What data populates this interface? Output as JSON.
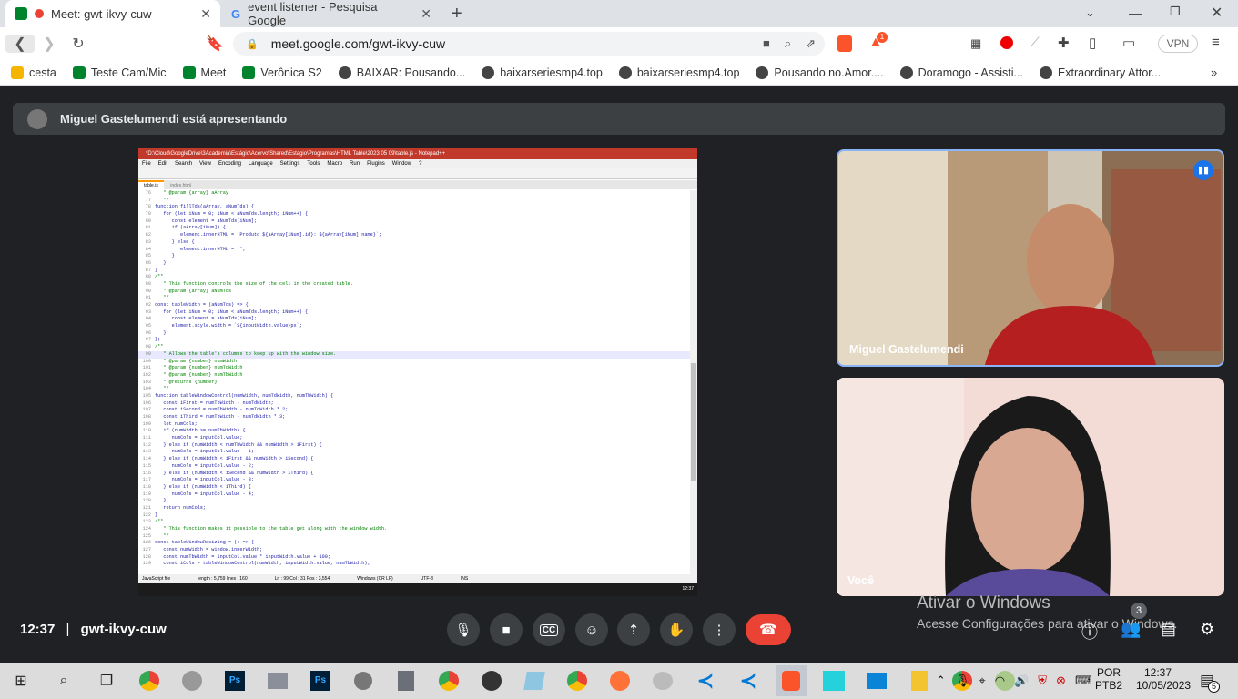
{
  "browser": {
    "tabs": [
      {
        "title": "Meet: gwt-ikvy-cuw",
        "active": true
      },
      {
        "title": "event listener - Pesquisa Google",
        "active": false
      }
    ],
    "url": "meet.google.com/gwt-ikvy-cuw",
    "vpn_label": "VPN",
    "extension_badge": "1",
    "bookmarks": [
      "cesta",
      "Teste Cam/Mic",
      "Meet",
      "Verônica S2",
      "BAIXAR: Pousando...",
      "baixarseriesmp4.top",
      "baixarseriesmp4.top",
      "Pousando.no.Amor....",
      "Doramogo - Assisti...",
      "Extraordinary Attor..."
    ]
  },
  "meet": {
    "presenting_banner": "Miguel Gastelumendi está apresentando",
    "participants": [
      {
        "name": "Miguel Gastelumendi"
      },
      {
        "name": "Você"
      }
    ],
    "time": "12:37",
    "separator": "|",
    "meeting_code": "gwt-ikvy-cuw",
    "people_count": "3",
    "activate_windows_title": "Ativar o Windows",
    "activate_windows_sub": "Acesse Configurações para ativar o Windows."
  },
  "shared_screen": {
    "window_title": "*D:\\Cloud\\GoogleDrive\\3Academia\\Estágio\\Acervo\\Shared\\Estagio\\Programas\\HTML Table\\2023 05 09\\table.js - Notepad++",
    "menu": [
      "File",
      "Edit",
      "Search",
      "View",
      "Encoding",
      "Language",
      "Settings",
      "Tools",
      "Macro",
      "Run",
      "Plugins",
      "Window",
      "?"
    ],
    "tabs": [
      "table.js",
      "index.html"
    ],
    "code_lines": [
      {
        "n": "76",
        "t": "   * @param {array} aArray"
      },
      {
        "n": "77",
        "t": "   */"
      },
      {
        "n": "78",
        "t": "function fillTds(aArray, aNumTds) {"
      },
      {
        "n": "79",
        "t": "   for (let iNum = 0; iNum < aNumTds.length; iNum++) {"
      },
      {
        "n": "80",
        "t": "      const element = aNumTds[iNum];"
      },
      {
        "n": "81",
        "t": "      if (aArray[iNum]) {"
      },
      {
        "n": "82",
        "t": "         element.innerHTML = `Produto ${aArray[iNum].id}: ${aArray[iNum].name}`;"
      },
      {
        "n": "83",
        "t": "      } else {"
      },
      {
        "n": "84",
        "t": "         element.innerHTML = '';"
      },
      {
        "n": "85",
        "t": "      }"
      },
      {
        "n": "86",
        "t": "   }"
      },
      {
        "n": "87",
        "t": "}"
      },
      {
        "n": "88",
        "t": "/**"
      },
      {
        "n": "89",
        "t": "   * This function controls the size of the cell in the created table."
      },
      {
        "n": "90",
        "t": "   * @param {array} aNumTds"
      },
      {
        "n": "91",
        "t": "   */"
      },
      {
        "n": "92",
        "t": "const tableWidth = (aNumTds) => {"
      },
      {
        "n": "93",
        "t": "   for (let iNum = 0; iNum < aNumTds.length; iNum++) {"
      },
      {
        "n": "94",
        "t": "      const element = aNumTds[iNum];"
      },
      {
        "n": "95",
        "t": "      element.style.width = `${inputWidth.value}px`;"
      },
      {
        "n": "96",
        "t": "   }"
      },
      {
        "n": "97",
        "t": "};"
      },
      {
        "n": "98",
        "t": "/**"
      },
      {
        "n": "99",
        "t": "   * Allows the table's columns to keep up with the window size."
      },
      {
        "n": "100",
        "t": "   * @param {number} numWidth"
      },
      {
        "n": "101",
        "t": "   * @param {number} numTdWidth"
      },
      {
        "n": "102",
        "t": "   * @param {number} numTbWidth"
      },
      {
        "n": "103",
        "t": "   * @returns {number}"
      },
      {
        "n": "104",
        "t": "   */"
      },
      {
        "n": "105",
        "t": "function tableWindowControl(numWidth, numTdWidth, numTbWidth) {"
      },
      {
        "n": "106",
        "t": "   const iFirst = numTbWidth - numTdWidth;"
      },
      {
        "n": "107",
        "t": "   const iSecond = numTbWidth - numTdWidth * 2;"
      },
      {
        "n": "108",
        "t": "   const iThird = numTbWidth - numTdWidth * 3;"
      },
      {
        "n": "109",
        "t": "   let numCols;"
      },
      {
        "n": "110",
        "t": "   if (numWidth >= numTbWidth) {"
      },
      {
        "n": "111",
        "t": "      numCols = inputCol.value;"
      },
      {
        "n": "112",
        "t": "   } else if (numWidth < numTbWidth && numWidth > iFirst) {"
      },
      {
        "n": "113",
        "t": "      numCols = inputCol.value - 1;"
      },
      {
        "n": "114",
        "t": "   } else if (numWidth < iFirst && numWidth > iSecond) {"
      },
      {
        "n": "115",
        "t": "      numCols = inputCol.value - 2;"
      },
      {
        "n": "116",
        "t": "   } else if (numWidth < iSecond && numWidth > iThird) {"
      },
      {
        "n": "117",
        "t": "      numCols = inputCol.value - 3;"
      },
      {
        "n": "118",
        "t": "   } else if (numWidth < iThird) {"
      },
      {
        "n": "119",
        "t": "      numCols = inputCol.value - 4;"
      },
      {
        "n": "120",
        "t": "   }"
      },
      {
        "n": "121",
        "t": "   return numCols;"
      },
      {
        "n": "122",
        "t": "}"
      },
      {
        "n": "123",
        "t": "/**"
      },
      {
        "n": "124",
        "t": "   * This function makes it possible to the table get along with the window width."
      },
      {
        "n": "125",
        "t": "   */"
      },
      {
        "n": "126",
        "t": "const tableWindowResizing = () => {"
      },
      {
        "n": "127",
        "t": "   const numWidth = window.innerWidth;"
      },
      {
        "n": "128",
        "t": "   const numTbWidth = inputCol.value * inputWidth.value + 100;"
      },
      {
        "n": "129",
        "t": "   const iCols = tableWindowControl(numWidth, inputWidth.value, numTbWidth);"
      }
    ],
    "status": [
      "JavaScript file",
      "length : 5,759    lines : 160",
      "Ln : 99    Col : 31    Pos : 3,554",
      "Windows (CR LF)",
      "UTF-8",
      "INS"
    ],
    "taskbar_time": "12:37"
  },
  "windows": {
    "lang": "POR",
    "lang_sub": "PTB2",
    "time": "12:37",
    "date": "10/05/2023",
    "notifications": "5"
  },
  "colors": {
    "meet_bg": "#202124",
    "leave_red": "#ea4335",
    "notepad_title": "#c0392b"
  }
}
